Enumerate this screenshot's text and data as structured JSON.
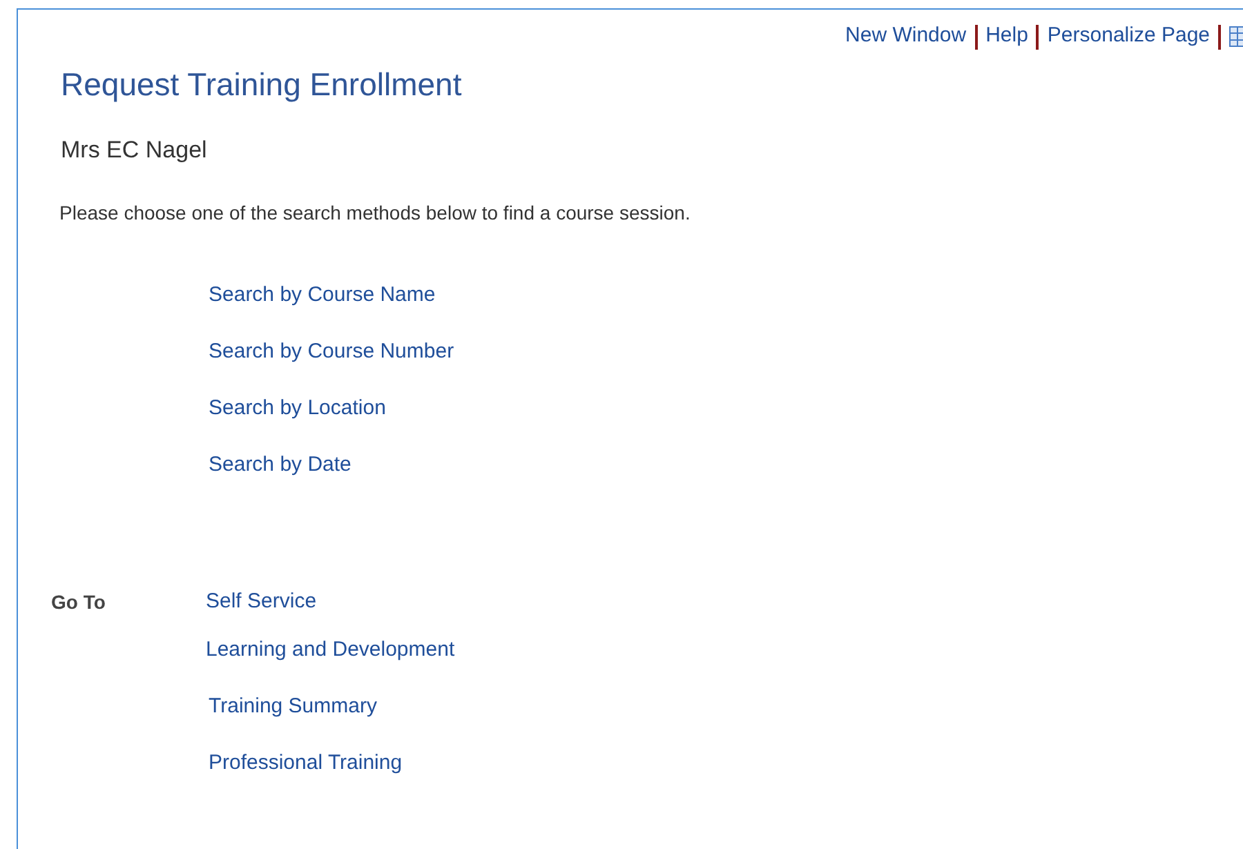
{
  "header_links": [
    "New Window",
    "Help",
    "Personalize Page"
  ],
  "title": "Request Training Enrollment",
  "person_name": "Mrs EC Nagel",
  "instruction": "Please choose one of the search methods below to find a course session.",
  "search_links": [
    "Search by Course Name",
    "Search by Course Number",
    "Search by Location",
    "Search by Date"
  ],
  "go_to": {
    "label": "Go To",
    "links": [
      "Self Service",
      "Learning and Development",
      "Training Summary",
      "Professional Training"
    ]
  }
}
